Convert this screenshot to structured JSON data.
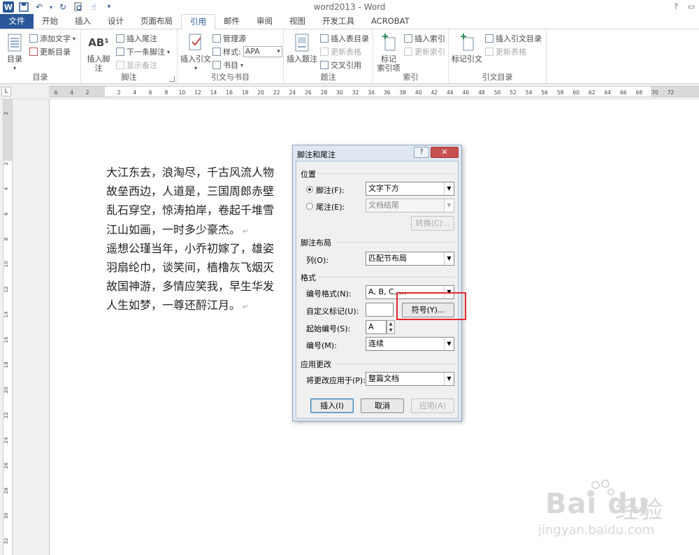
{
  "window": {
    "title": "word2013 - Word",
    "help": "?"
  },
  "tabs": [
    "文件",
    "开始",
    "插入",
    "设计",
    "页面布局",
    "引用",
    "邮件",
    "审阅",
    "视图",
    "开发工具",
    "ACROBAT"
  ],
  "ribbon": {
    "toc": {
      "big": "目录",
      "add_text": "添加文字",
      "update": "更新目录",
      "label": "目录"
    },
    "footnote": {
      "big": "插入脚注",
      "big_icon_text": "AB¹",
      "insert_endnote": "插入尾注",
      "next": "下一条脚注",
      "show": "显示备注",
      "label": "脚注"
    },
    "citation": {
      "big": "插入引文",
      "manage": "管理源",
      "style_label": "样式:",
      "style_value": "APA",
      "biblio": "书目",
      "label": "引文与书目"
    },
    "captions": {
      "big": "插入题注",
      "insert_tof": "插入表目录",
      "update_table": "更新表格",
      "cross_ref": "交叉引用",
      "label": "题注"
    },
    "index": {
      "big": "标记\n索引项",
      "big1": "标记",
      "big2": "索引项",
      "insert_index": "插入索引",
      "update_index": "更新索引",
      "label": "索引"
    },
    "toa": {
      "big": "标记引文",
      "insert_toa": "插入引文目录",
      "update_table": "更新表格",
      "label": "引文目录"
    }
  },
  "ruler": {
    "corner": "L",
    "h_ticks": [
      "6",
      "4",
      "2",
      "",
      "2",
      "4",
      "6",
      "8",
      "10",
      "12",
      "14",
      "16",
      "18",
      "20",
      "22",
      "24",
      "26",
      "28",
      "30",
      "32",
      "34",
      "36",
      "38",
      "40",
      "42",
      "44",
      "46",
      "48",
      "50",
      "52",
      "54",
      "56",
      "58",
      "60",
      "62",
      "64",
      "66",
      "68",
      "70",
      "72"
    ],
    "v_ticks": [
      "2",
      "",
      "2",
      "4",
      "6",
      "8",
      "10",
      "12",
      "14",
      "16",
      "18",
      "20",
      "22",
      "24",
      "26",
      "28",
      "30",
      "32"
    ]
  },
  "document": {
    "lines": [
      {
        "text": "大江东去，浪淘尽，千古风流人物",
        "mark": false
      },
      {
        "text": "故垒西边，人道是，三国周郎赤壁",
        "mark": false
      },
      {
        "text": "乱石穿空，惊涛拍岸，卷起千堆雪",
        "mark": false
      },
      {
        "text": "江山如画，一时多少豪杰。",
        "mark": true
      },
      {
        "text": "遥想公瑾当年，小乔初嫁了，雄姿",
        "mark": false
      },
      {
        "text": "羽扇纶巾，谈笑间，樯橹灰飞烟灭",
        "mark": false
      },
      {
        "text": "故国神游，多情应笑我，早生华发",
        "mark": false
      },
      {
        "text": "人生如梦，一尊还酹江月。",
        "mark": true
      }
    ],
    "para_mark": "↵"
  },
  "dialog": {
    "title": "脚注和尾注",
    "close": "✕",
    "help": "?",
    "section_location": "位置",
    "footnote_label": "脚注(F):",
    "footnote_value": "文字下方",
    "endnote_label": "尾注(E):",
    "endnote_value": "文档结尾",
    "convert": "转换(C)...",
    "section_layout": "脚注布局",
    "columns_label": "列(O):",
    "columns_value": "匹配节布局",
    "section_format": "格式",
    "number_format_label": "编号格式(N):",
    "number_format_value": "A, B, C, ...",
    "custom_mark_label": "自定义标记(U):",
    "custom_mark_value": "",
    "symbol": "符号(Y)...",
    "start_at_label": "起始编号(S):",
    "start_at_value": "A",
    "numbering_label": "编号(M):",
    "numbering_value": "连续",
    "section_apply": "应用更改",
    "apply_to_label": "将更改应用于(P):",
    "apply_to_value": "整篇文档",
    "insert": "插入(I)",
    "cancel": "取消",
    "apply": "应用(A)"
  },
  "watermark": {
    "brand": "Bai du",
    "cn": "经验",
    "url": "jingyan.baidu.com"
  },
  "colors": {
    "accent": "#2b579a",
    "highlight": "#e3292d"
  }
}
